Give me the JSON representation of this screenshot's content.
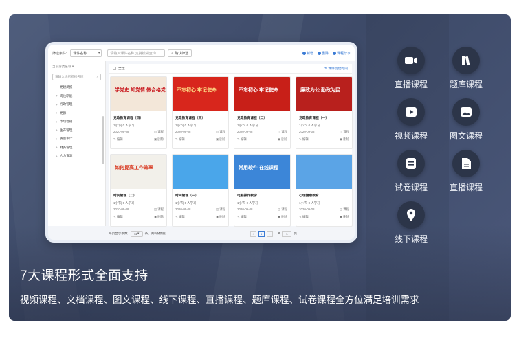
{
  "app": {
    "filter_label": "筛选条件:",
    "filter_value": "课件名称",
    "search_placeholder": "请输入课件名称,支持模糊查询",
    "confirm_search": "确认筛选",
    "actions": [
      "新增",
      "删除",
      "课程分享"
    ]
  },
  "sidebar": {
    "category_title": "当前分类名称",
    "search_placeholder": "请输入组织机构名称",
    "items": [
      {
        "label": "党建简报",
        "expandable": false
      },
      {
        "label": "岗位职能",
        "expandable": true
      },
      {
        "label": "行政管理",
        "expandable": true
      },
      {
        "label": "党群",
        "expandable": true
      },
      {
        "label": "市场营销",
        "expandable": true
      },
      {
        "label": "生产管理",
        "expandable": true
      },
      {
        "label": "质量审计",
        "expandable": true
      },
      {
        "label": "财务管理",
        "expandable": true
      },
      {
        "label": "人力资源",
        "expandable": true
      }
    ]
  },
  "list": {
    "select_all": "全选",
    "sort_label": "课件创建时间",
    "cards": [
      {
        "title": "党政教育课程（四）",
        "meta": "1小节| 0 人学习",
        "date": "2020-09-08",
        "kind": "课程",
        "edit": "编辑",
        "delete": "删除",
        "thumb_text": "学党史 知党情 做合格党员",
        "thumb_bg": "#f3e7d9",
        "thumb_fg": "#c8171d"
      },
      {
        "title": "党政教育课程（三）",
        "meta": "1小节| 0 人学习",
        "date": "2020-09-08",
        "kind": "课程",
        "edit": "编辑",
        "delete": "删除",
        "thumb_text": "不忘初心 牢记使命",
        "thumb_bg": "#d8261c",
        "thumb_fg": "#ffe28a"
      },
      {
        "title": "党政教育课程（二）",
        "meta": "1小节| 0 人学习",
        "date": "2020-09-08",
        "kind": "课程",
        "edit": "编辑",
        "delete": "删除",
        "thumb_text": "不忘初心 牢记使命",
        "thumb_bg": "#c81f18",
        "thumb_fg": "#ffffff"
      },
      {
        "title": "党政教育课程（一）",
        "meta": "1小节| 0 人学习",
        "date": "2020-09-08",
        "kind": "课程",
        "edit": "编辑",
        "delete": "删除",
        "thumb_text": "廉政为公 勤政为民",
        "thumb_bg": "#b8201d",
        "thumb_fg": "#ffffff"
      },
      {
        "title": "时间管理（二）",
        "meta": "1小节| 0 人学习",
        "date": "2020-09-08",
        "kind": "课程",
        "edit": "编辑",
        "delete": "删除",
        "thumb_text": "如何提高工作效率",
        "thumb_bg": "#f2f0ea",
        "thumb_fg": "#d8361e"
      },
      {
        "title": "时间管理（一）",
        "meta": "1小节| 0 人学习",
        "date": "2020-09-08",
        "kind": "课程",
        "edit": "编辑",
        "delete": "删除",
        "thumb_text": "",
        "thumb_bg": "#4aa6ea",
        "thumb_fg": "#ffffff"
      },
      {
        "title": "电脑操作教学",
        "meta": "1小节| 0 人学习",
        "date": "2020-09-08",
        "kind": "课程",
        "edit": "编辑",
        "delete": "删除",
        "thumb_text": "常用软件 在线课程",
        "thumb_bg": "#3c86d8",
        "thumb_fg": "#ffffff"
      },
      {
        "title": "心理健康教育",
        "meta": "1小节| 0 人学习",
        "date": "2020-09-08",
        "kind": "课程",
        "edit": "编辑",
        "delete": "删除",
        "thumb_text": "",
        "thumb_bg": "#5ba4e6",
        "thumb_fg": "#ffffff"
      }
    ]
  },
  "footer": {
    "per_page_label": "每页显示条数",
    "per_page": "12",
    "total": "条，共8条数据",
    "page": "1",
    "goto": "1",
    "goto_suffix": "页"
  },
  "features": [
    {
      "label": "直播课程",
      "icon": "video-camera-icon"
    },
    {
      "label": "题库课程",
      "icon": "books-icon"
    },
    {
      "label": "视频课程",
      "icon": "play-icon"
    },
    {
      "label": "图文课程",
      "icon": "image-icon"
    },
    {
      "label": "试卷课程",
      "icon": "exam-paper-icon"
    },
    {
      "label": "直播课程",
      "icon": "document-icon"
    },
    {
      "label": "线下课程",
      "icon": "location-pin-icon"
    }
  ],
  "headline": "7大课程形式全面支持",
  "subline": "视频课程、文档课程、图文课程、线下课程、直播课程、题库课程、试卷课程全方位满足培训需求"
}
